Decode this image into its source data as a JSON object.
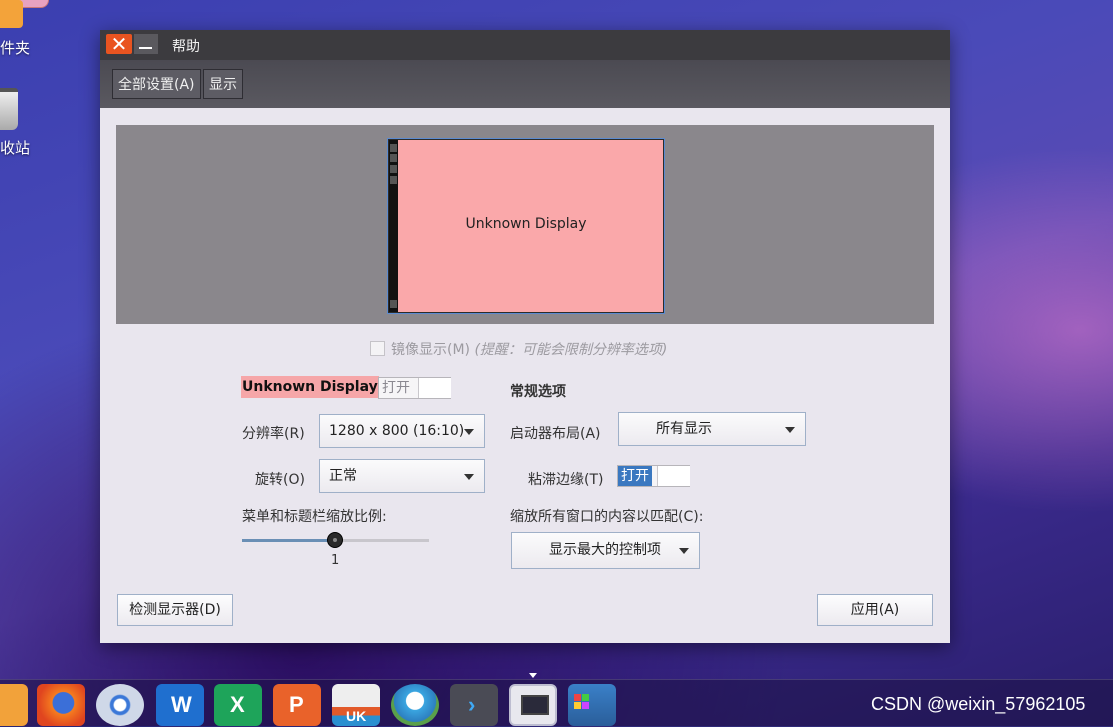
{
  "desktop": {
    "icons": [
      {
        "label": "件夹"
      },
      {
        "label": "收站"
      }
    ]
  },
  "window": {
    "title": "帮助",
    "breadcrumbs": [
      "全部设置(A)",
      "显示"
    ],
    "monitor_label": "Unknown Display",
    "mirror_label": "镜像显示(M)",
    "mirror_hint": "(提醒：可能会限制分辨率选项)",
    "display_name": "Unknown Display",
    "display_toggle": {
      "label": "打开",
      "on": false
    },
    "resolution_label": "分辨率(R)",
    "resolution_value": "1280 x 800 (16:10)",
    "rotation_label": "旋转(O)",
    "rotation_value": "正常",
    "scale_label": "菜单和标题栏缩放比例:",
    "scale_value": "1",
    "scale_level": 0.5,
    "general_title": "常规选项",
    "launcher_label": "启动器布局(A)",
    "launcher_value": "所有显示",
    "sticky_label": "粘滞边缘(T)",
    "sticky_toggle": {
      "label": "打开",
      "on": true
    },
    "fit_label": "缩放所有窗口的内容以匹配(C):",
    "fit_value": "显示最大的控制项",
    "detect_button": "检测显示器(D)",
    "apply_button": "应用(A)"
  },
  "dock": {
    "apps": [
      "files",
      "firefox",
      "chromium",
      "wps-writer",
      "wps-spreadsheets",
      "wps-presentation",
      "ubuntu-kylin-software",
      "kylin-assistant",
      "terminal",
      "display-settings",
      "workspaces"
    ],
    "active_app": "display-settings"
  },
  "watermark": "CSDN @weixin_57962105",
  "colors": {
    "accent_orange": "#e95420",
    "toggle_on": "#3a78c0",
    "display_highlight": "#f6a6a8"
  }
}
